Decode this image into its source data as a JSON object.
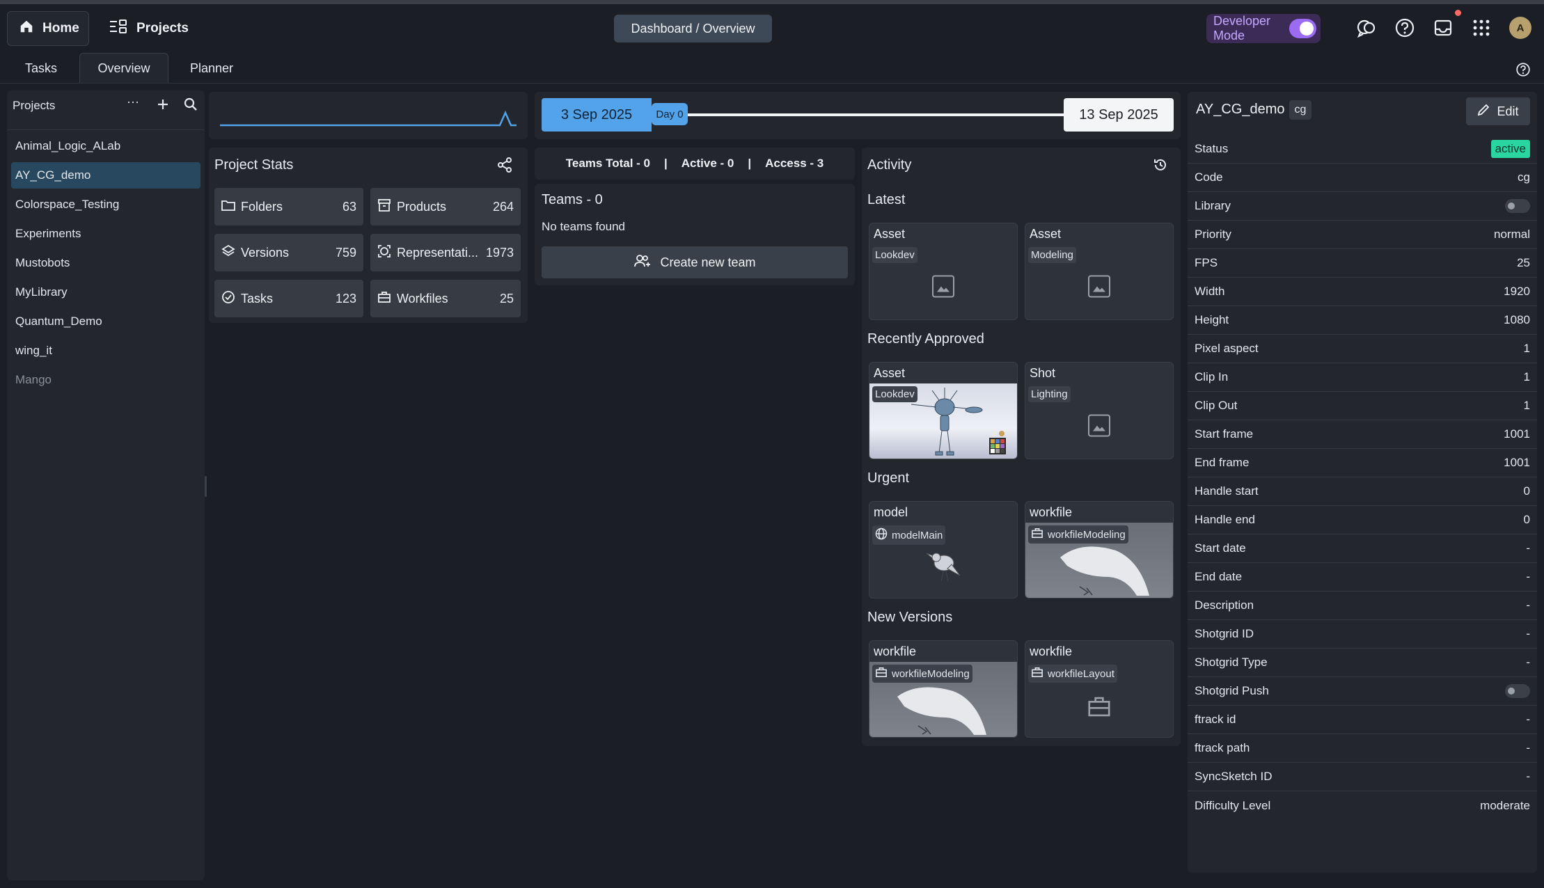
{
  "header": {
    "home_label": "Home",
    "projects_label": "Projects",
    "breadcrumb": "Dashboard / Overview",
    "dev_mode_label": "Developer Mode",
    "avatar_initial": "A"
  },
  "tabs": [
    {
      "label": "Tasks"
    },
    {
      "label": "Overview",
      "active": true
    },
    {
      "label": "Planner"
    }
  ],
  "sidebar": {
    "title": "Projects",
    "more_label": "···",
    "items": [
      {
        "label": "Animal_Logic_ALab"
      },
      {
        "label": "AY_CG_demo",
        "selected": true
      },
      {
        "label": "Colorspace_Testing"
      },
      {
        "label": "Experiments"
      },
      {
        "label": "Mustobots"
      },
      {
        "label": "MyLibrary"
      },
      {
        "label": "Quantum_Demo"
      },
      {
        "label": "wing_it"
      },
      {
        "label": "Mango",
        "inactive": true
      }
    ]
  },
  "project_stats": {
    "title": "Project Stats",
    "cards": [
      {
        "label": "Folders",
        "value": "63",
        "icon": "folder-icon"
      },
      {
        "label": "Products",
        "value": "264",
        "icon": "product-icon"
      },
      {
        "label": "Versions",
        "value": "759",
        "icon": "layers-icon"
      },
      {
        "label": "Representati...",
        "value": "1973",
        "icon": "representation-icon"
      },
      {
        "label": "Tasks",
        "value": "123",
        "icon": "check-circle-icon"
      },
      {
        "label": "Workfiles",
        "value": "25",
        "icon": "briefcase-icon"
      }
    ]
  },
  "timeline": {
    "start": "3 Sep 2025",
    "day_badge": "Day 0",
    "end": "13 Sep 2025"
  },
  "teams": {
    "summary_total": "Teams Total - 0",
    "summary_sep1": "|",
    "summary_active": "Active - 0",
    "summary_sep2": "|",
    "summary_access": "Access - 3",
    "title": "Teams - 0",
    "empty": "No teams found",
    "create_label": "Create new team"
  },
  "activity": {
    "title": "Activity",
    "sections": {
      "latest": {
        "title": "Latest",
        "cards": [
          {
            "head": "Asset",
            "chip": "Lookdev"
          },
          {
            "head": "Asset",
            "chip": "Modeling"
          }
        ]
      },
      "approved": {
        "title": "Recently Approved",
        "cards": [
          {
            "head": "Asset",
            "chip": "Lookdev"
          },
          {
            "head": "Shot",
            "chip": "Lighting"
          }
        ]
      },
      "urgent": {
        "title": "Urgent",
        "cards": [
          {
            "head": "model",
            "chip": "modelMain"
          },
          {
            "head": "workfile",
            "chip": "workfileModeling"
          }
        ]
      },
      "new_versions": {
        "title": "New Versions",
        "cards": [
          {
            "head": "workfile",
            "chip": "workfileModeling"
          },
          {
            "head": "workfile",
            "chip": "workfileLayout"
          }
        ]
      }
    }
  },
  "details": {
    "name": "AY_CG_demo",
    "code_tag": "cg",
    "edit_label": "Edit",
    "rows": [
      {
        "k": "Status",
        "v": "active",
        "type": "pill"
      },
      {
        "k": "Code",
        "v": "cg"
      },
      {
        "k": "Library",
        "v": "",
        "type": "toggle"
      },
      {
        "k": "Priority",
        "v": "normal"
      },
      {
        "k": "FPS",
        "v": "25"
      },
      {
        "k": "Width",
        "v": "1920"
      },
      {
        "k": "Height",
        "v": "1080"
      },
      {
        "k": "Pixel aspect",
        "v": "1"
      },
      {
        "k": "Clip In",
        "v": "1"
      },
      {
        "k": "Clip Out",
        "v": "1"
      },
      {
        "k": "Start frame",
        "v": "1001"
      },
      {
        "k": "End frame",
        "v": "1001"
      },
      {
        "k": "Handle start",
        "v": "0"
      },
      {
        "k": "Handle end",
        "v": "0"
      },
      {
        "k": "Start date",
        "v": "-"
      },
      {
        "k": "End date",
        "v": "-"
      },
      {
        "k": "Description",
        "v": "-"
      },
      {
        "k": "Shotgrid ID",
        "v": "-"
      },
      {
        "k": "Shotgrid Type",
        "v": "-"
      },
      {
        "k": "Shotgrid Push",
        "v": "",
        "type": "toggle"
      },
      {
        "k": "ftrack id",
        "v": "-"
      },
      {
        "k": "ftrack path",
        "v": "-"
      },
      {
        "k": "SyncSketch ID",
        "v": "-"
      },
      {
        "k": "Difficulty Level",
        "v": "moderate"
      }
    ]
  },
  "colors": {
    "accent_blue": "#52a3ea",
    "active_green": "#2ad6a0",
    "dev_purple": "#9b6cf3",
    "selected_row": "#27485f"
  }
}
